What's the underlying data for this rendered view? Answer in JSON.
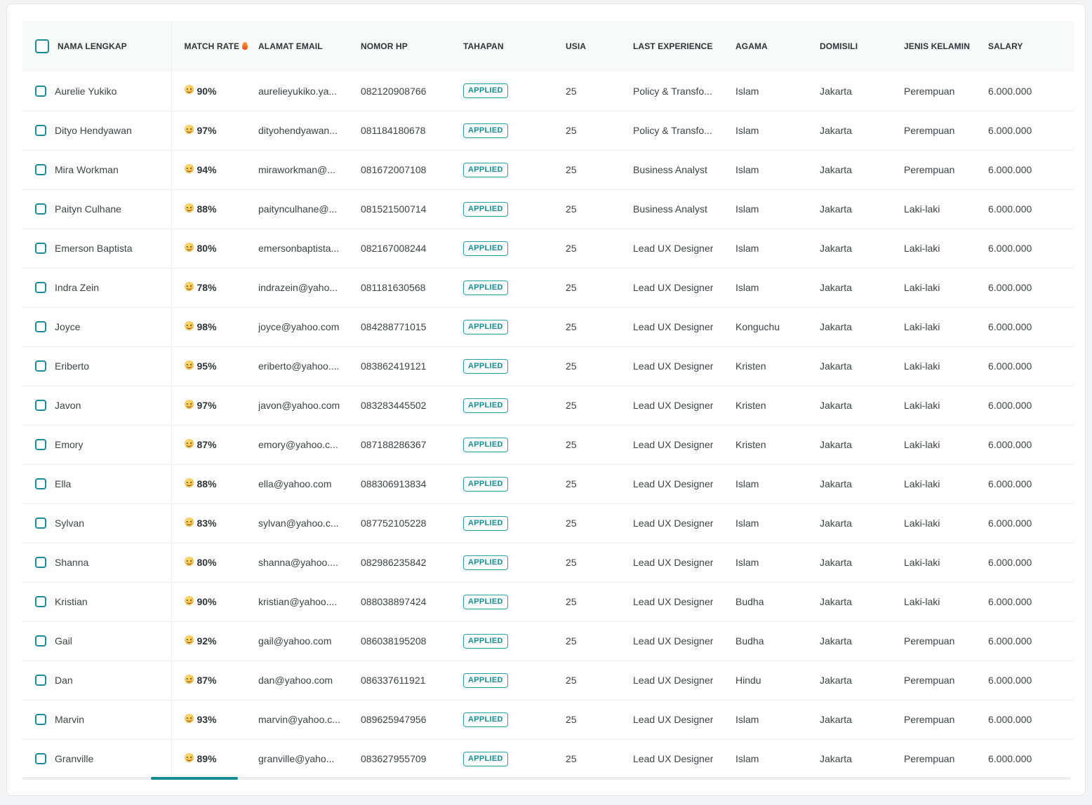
{
  "accent_color": "#1a8c95",
  "columns": {
    "name": "NAMA LENGKAP",
    "match": "MATCH RATE",
    "email": "ALAMAT EMAIL",
    "phone": "NOMOR HP",
    "stage": "TAHAPAN",
    "age": "USIA",
    "experience": "LAST EXPERIENCE",
    "religion": "AGAMA",
    "domicile": "DOMISILI",
    "gender": "JENIS KELAMIN",
    "salary": "SALARY"
  },
  "icons": {
    "match_header": "fire-icon",
    "match_cell": "star-struck-face-icon"
  },
  "rows": [
    {
      "name": "Aurelie Yukiko",
      "match": "90%",
      "email": "aurelieyukiko.ya...",
      "phone": "082120908766",
      "stage": "APPLIED",
      "age": "25",
      "experience": "Policy & Transfo...",
      "religion": "Islam",
      "domicile": "Jakarta",
      "gender": "Perempuan",
      "salary": "6.000.000"
    },
    {
      "name": "Dityo Hendyawan",
      "match": "97%",
      "email": "dityohendyawan...",
      "phone": "081184180678",
      "stage": "APPLIED",
      "age": "25",
      "experience": "Policy & Transfo...",
      "religion": "Islam",
      "domicile": "Jakarta",
      "gender": "Perempuan",
      "salary": "6.000.000"
    },
    {
      "name": "Mira Workman",
      "match": "94%",
      "email": "miraworkman@...",
      "phone": "081672007108",
      "stage": "APPLIED",
      "age": "25",
      "experience": "Business Analyst",
      "religion": "Islam",
      "domicile": "Jakarta",
      "gender": "Perempuan",
      "salary": "6.000.000"
    },
    {
      "name": "Paityn Culhane",
      "match": "88%",
      "email": "paitynculhane@...",
      "phone": "081521500714",
      "stage": "APPLIED",
      "age": "25",
      "experience": "Business Analyst",
      "religion": "Islam",
      "domicile": "Jakarta",
      "gender": "Laki-laki",
      "salary": "6.000.000"
    },
    {
      "name": "Emerson Baptista",
      "match": "80%",
      "email": "emersonbaptista...",
      "phone": "082167008244",
      "stage": "APPLIED",
      "age": "25",
      "experience": "Lead UX Designer",
      "religion": "Islam",
      "domicile": "Jakarta",
      "gender": "Laki-laki",
      "salary": "6.000.000"
    },
    {
      "name": "Indra Zein",
      "match": "78%",
      "email": "indrazein@yaho...",
      "phone": "081181630568",
      "stage": "APPLIED",
      "age": "25",
      "experience": "Lead UX Designer",
      "religion": "Islam",
      "domicile": "Jakarta",
      "gender": "Laki-laki",
      "salary": "6.000.000"
    },
    {
      "name": "Joyce",
      "match": "98%",
      "email": "joyce@yahoo.com",
      "phone": "084288771015",
      "stage": "APPLIED",
      "age": "25",
      "experience": "Lead UX Designer",
      "religion": "Konguchu",
      "domicile": "Jakarta",
      "gender": "Laki-laki",
      "salary": "6.000.000"
    },
    {
      "name": "Eriberto",
      "match": "95%",
      "email": "eriberto@yahoo....",
      "phone": "083862419121",
      "stage": "APPLIED",
      "age": "25",
      "experience": "Lead UX Designer",
      "religion": "Kristen",
      "domicile": "Jakarta",
      "gender": "Laki-laki",
      "salary": "6.000.000"
    },
    {
      "name": "Javon",
      "match": "97%",
      "email": "javon@yahoo.com",
      "phone": "083283445502",
      "stage": "APPLIED",
      "age": "25",
      "experience": "Lead UX Designer",
      "religion": "Kristen",
      "domicile": "Jakarta",
      "gender": "Laki-laki",
      "salary": "6.000.000"
    },
    {
      "name": "Emory",
      "match": "87%",
      "email": "emory@yahoo.c...",
      "phone": "087188286367",
      "stage": "APPLIED",
      "age": "25",
      "experience": "Lead UX Designer",
      "religion": "Kristen",
      "domicile": "Jakarta",
      "gender": "Laki-laki",
      "salary": "6.000.000"
    },
    {
      "name": "Ella",
      "match": "88%",
      "email": "ella@yahoo.com",
      "phone": "088306913834",
      "stage": "APPLIED",
      "age": "25",
      "experience": "Lead UX Designer",
      "religion": "Islam",
      "domicile": "Jakarta",
      "gender": "Laki-laki",
      "salary": "6.000.000"
    },
    {
      "name": "Sylvan",
      "match": "83%",
      "email": "sylvan@yahoo.c...",
      "phone": "087752105228",
      "stage": "APPLIED",
      "age": "25",
      "experience": "Lead UX Designer",
      "religion": "Islam",
      "domicile": "Jakarta",
      "gender": "Laki-laki",
      "salary": "6.000.000"
    },
    {
      "name": "Shanna",
      "match": "80%",
      "email": "shanna@yahoo....",
      "phone": "082986235842",
      "stage": "APPLIED",
      "age": "25",
      "experience": "Lead UX Designer",
      "religion": "Islam",
      "domicile": "Jakarta",
      "gender": "Laki-laki",
      "salary": "6.000.000"
    },
    {
      "name": "Kristian",
      "match": "90%",
      "email": "kristian@yahoo....",
      "phone": "088038897424",
      "stage": "APPLIED",
      "age": "25",
      "experience": "Lead UX Designer",
      "religion": "Budha",
      "domicile": "Jakarta",
      "gender": "Laki-laki",
      "salary": "6.000.000"
    },
    {
      "name": "Gail",
      "match": "92%",
      "email": "gail@yahoo.com",
      "phone": "086038195208",
      "stage": "APPLIED",
      "age": "25",
      "experience": "Lead UX Designer",
      "religion": "Budha",
      "domicile": "Jakarta",
      "gender": "Perempuan",
      "salary": "6.000.000"
    },
    {
      "name": "Dan",
      "match": "87%",
      "email": "dan@yahoo.com",
      "phone": "086337611921",
      "stage": "APPLIED",
      "age": "25",
      "experience": "Lead UX Designer",
      "religion": "Hindu",
      "domicile": "Jakarta",
      "gender": "Perempuan",
      "salary": "6.000.000"
    },
    {
      "name": "Marvin",
      "match": "93%",
      "email": "marvin@yahoo.c...",
      "phone": "089625947956",
      "stage": "APPLIED",
      "age": "25",
      "experience": "Lead UX Designer",
      "religion": "Islam",
      "domicile": "Jakarta",
      "gender": "Perempuan",
      "salary": "6.000.000"
    },
    {
      "name": "Granville",
      "match": "89%",
      "email": "granville@yaho...",
      "phone": "083627955709",
      "stage": "APPLIED",
      "age": "25",
      "experience": "Lead UX Designer",
      "religion": "Islam",
      "domicile": "Jakarta",
      "gender": "Perempuan",
      "salary": "6.000.000"
    }
  ]
}
